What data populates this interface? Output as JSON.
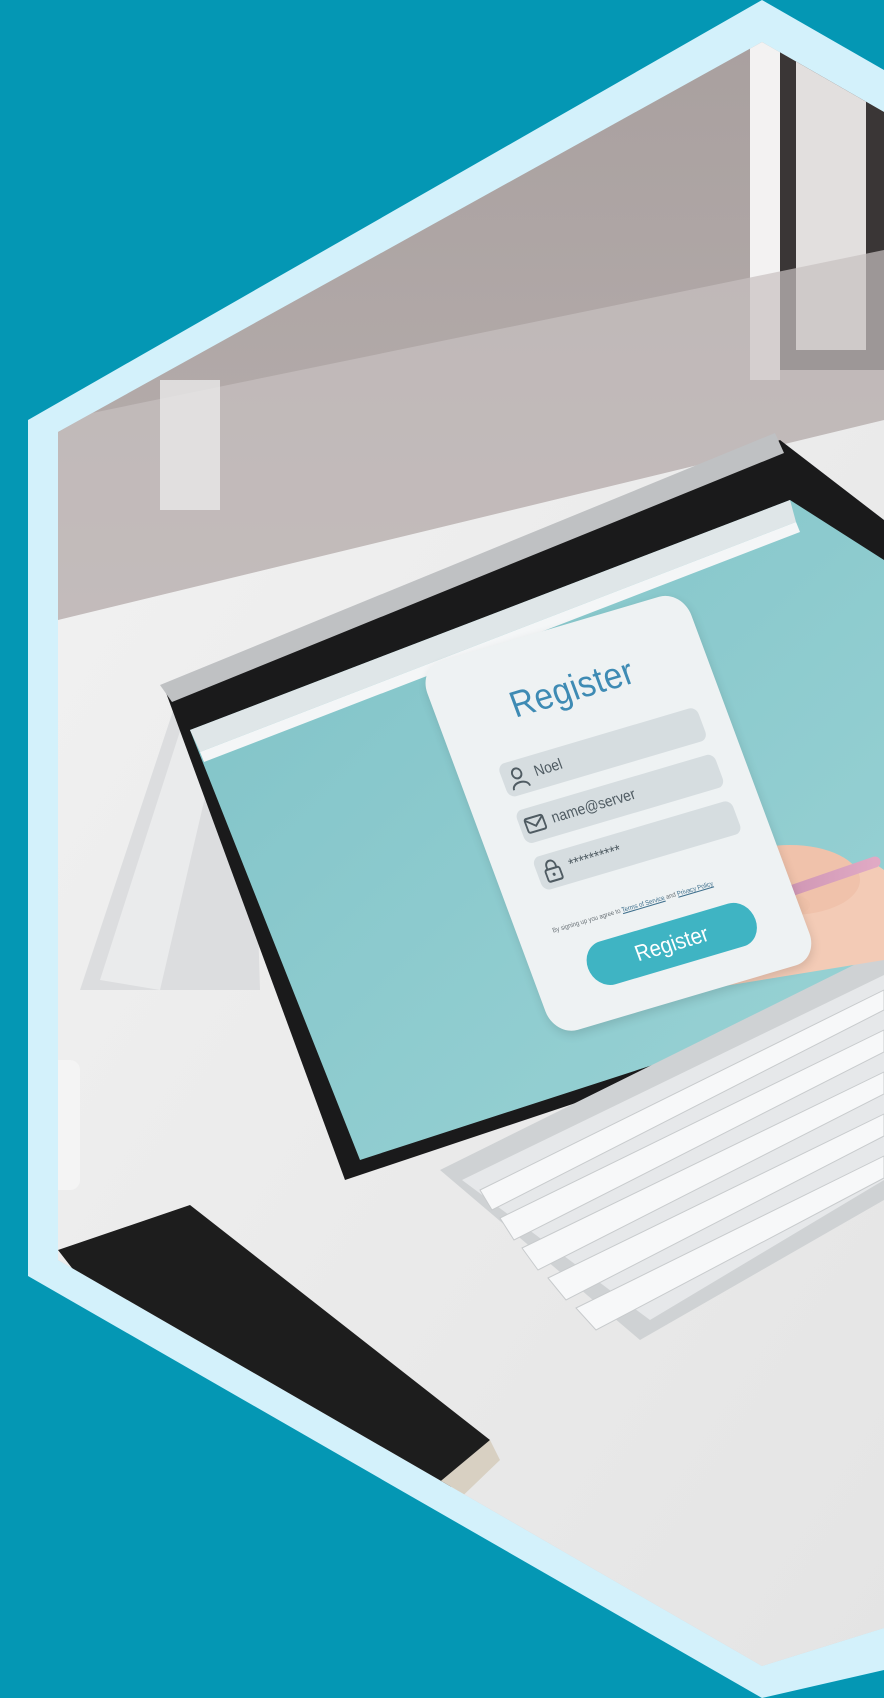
{
  "photo": {
    "subject": "laptop-register-screen",
    "colors": {
      "background": "#0497b4",
      "hex_border": "#d3f1fb",
      "screen_bg": "#86c8cc",
      "card": "#eef2f3",
      "accent": "#3fb4c3",
      "title": "#3e8bb4"
    }
  },
  "register_form": {
    "title": "Register",
    "name_value": "Noel",
    "email_value": "name@server",
    "password_value": "**********",
    "terms_prefix": "By signing up you agree to ",
    "terms_link": "Terms of Service",
    "terms_and": " and ",
    "privacy_link": "Privacy Policy",
    "button_label": "Register",
    "icons": [
      "user-icon",
      "envelope-icon",
      "lock-icon"
    ]
  }
}
